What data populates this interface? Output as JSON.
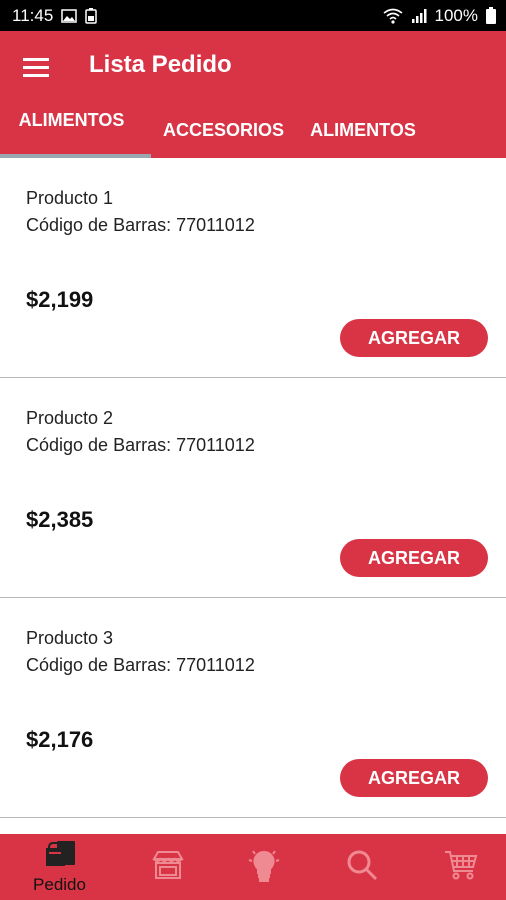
{
  "status_bar": {
    "time": "11:45",
    "battery": "100%"
  },
  "app_bar": {
    "title": "Lista Pedido",
    "tabs": [
      {
        "label": "ALIMENTOS",
        "selected": true
      },
      {
        "label": "ACCESORIOS",
        "selected": false
      },
      {
        "label": "ALIMENTOS",
        "selected": false
      }
    ]
  },
  "products": [
    {
      "name": "Producto 1",
      "barcode": "Código de Barras: 77011012",
      "price": "$2,199",
      "button": "AGREGAR"
    },
    {
      "name": "Producto 2",
      "barcode": "Código de Barras: 77011012",
      "price": "$2,385",
      "button": "AGREGAR"
    },
    {
      "name": "Producto 3",
      "barcode": "Código de Barras: 77011012",
      "price": "$2,176",
      "button": "AGREGAR"
    }
  ],
  "bottom_nav": {
    "items": [
      {
        "icon": "pedido-icon",
        "label": "Pedido",
        "active": true
      },
      {
        "icon": "store-icon",
        "label": "",
        "active": false
      },
      {
        "icon": "lightbulb-icon",
        "label": "",
        "active": false
      },
      {
        "icon": "search-icon",
        "label": "",
        "active": false
      },
      {
        "icon": "cart-icon",
        "label": "",
        "active": false
      }
    ]
  },
  "colors": {
    "primary": "#d83446",
    "tab_indicator": "#9aa7b1",
    "inactive_icon": "#f08a92"
  }
}
